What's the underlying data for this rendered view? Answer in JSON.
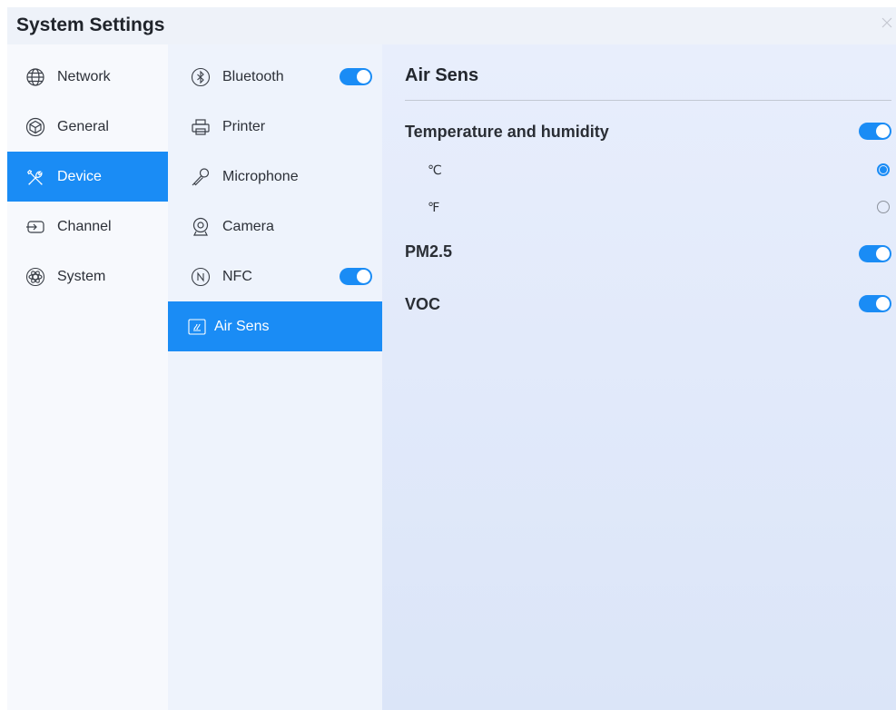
{
  "window": {
    "title": "System Settings"
  },
  "colors": {
    "accent": "#1a8cf5",
    "active_text": "#ffffff"
  },
  "nav": {
    "items": [
      {
        "label": "Network",
        "icon": "globe-icon",
        "active": false
      },
      {
        "label": "General",
        "icon": "cube-icon",
        "active": false
      },
      {
        "label": "Device",
        "icon": "tools-icon",
        "active": true
      },
      {
        "label": "Channel",
        "icon": "input-source-icon",
        "active": false
      },
      {
        "label": "System",
        "icon": "atom-icon",
        "active": false
      }
    ]
  },
  "device_menu": {
    "items": [
      {
        "label": "Bluetooth",
        "icon": "bluetooth-icon",
        "toggle": true,
        "active": false
      },
      {
        "label": "Printer",
        "icon": "printer-icon",
        "active": false
      },
      {
        "label": "Microphone",
        "icon": "microphone-icon",
        "active": false
      },
      {
        "label": "Camera",
        "icon": "camera-icon",
        "active": false
      },
      {
        "label": "NFC",
        "icon": "nfc-icon",
        "toggle": true,
        "active": false
      },
      {
        "label": "Air Sens",
        "icon": "air-sensor-icon",
        "active": true
      }
    ]
  },
  "air_sens": {
    "title": "Air Sens",
    "temp_humidity": {
      "label": "Temperature and humidity",
      "enabled": true
    },
    "units": [
      {
        "label": "℃",
        "selected": true
      },
      {
        "label": "℉",
        "selected": false
      }
    ],
    "pm25": {
      "label": "PM2.5",
      "enabled": true
    },
    "voc": {
      "label": "VOC",
      "enabled": true
    }
  }
}
